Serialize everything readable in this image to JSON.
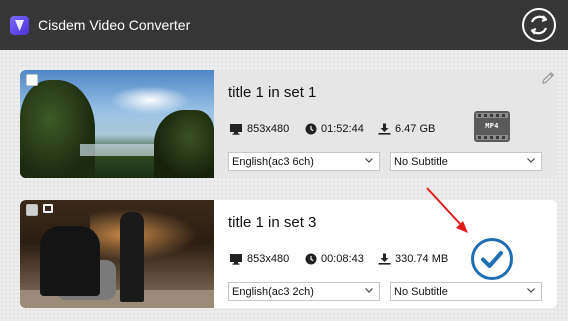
{
  "app": {
    "title": "Cisdem Video Converter",
    "logo_icon": "app-logo-icon",
    "sync_icon": "sync-icon"
  },
  "colors": {
    "titlebar": "#363636",
    "checkmark": "#1f6fb3",
    "annotation_arrow": "#e01b1b",
    "card_selected": "#e6e6e6",
    "card_default": "#ffffff"
  },
  "items": [
    {
      "title": "title 1 in set 1",
      "resolution": "853x480",
      "duration": "01:52:44",
      "size": "6.47 GB",
      "audio": "English(ac3 6ch)",
      "subtitle": "No Subtitle",
      "status_icon": "mp4-format-icon",
      "format_label": "MP4",
      "checked": false
    },
    {
      "title": "title 1 in set 3",
      "resolution": "853x480",
      "duration": "00:08:43",
      "size": "330.74 MB",
      "audio": "English(ac3 2ch)",
      "subtitle": "No Subtitle",
      "status_icon": "checkmark-done-icon",
      "checked": false
    }
  ]
}
